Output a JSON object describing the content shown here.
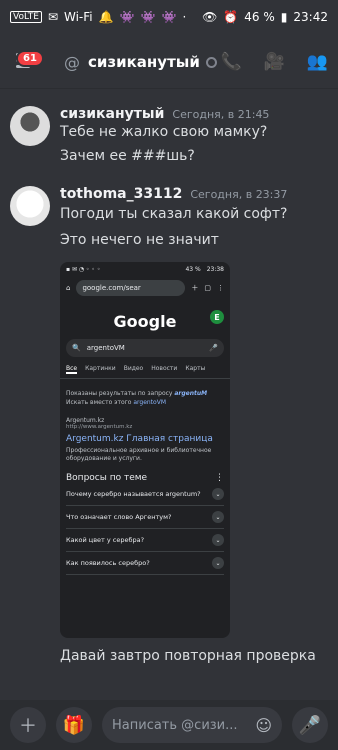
{
  "status": {
    "left_icons": [
      "VoLTE",
      "✉",
      "Wi‑Fi",
      "🔔",
      "👾",
      "👾",
      "👾",
      "·"
    ],
    "right": {
      "battery": "46 %",
      "time": "23:42"
    }
  },
  "header": {
    "badge_count": "61",
    "at_symbol": "@",
    "title": "сизиканутый",
    "icons": [
      "call-icon",
      "video-icon",
      "members-icon"
    ]
  },
  "messages": [
    {
      "username": "сизиканутый",
      "timestamp": "Сегодня, в 21:45",
      "lines": [
        "Тебе не жалко свою мамку?",
        "Зачем ее ###шь?"
      ]
    },
    {
      "username": "tothoma_33112",
      "timestamp": "Сегодня, в 23:37",
      "lines": [
        "Погоди ты сказал какой софт?",
        "Это нечего не значит"
      ],
      "after_image": "Давай завтро повторная проверка"
    }
  ],
  "screenshot": {
    "status_time": "23:38",
    "battery": "43 %",
    "url": "google.com/sear",
    "google_logo": "Google",
    "avatar_letter": "E",
    "query": "argentoVM",
    "tabs": [
      "Все",
      "Картинки",
      "Видео",
      "Новости",
      "Карты"
    ],
    "info_line1_prefix": "Показаны результаты по запросу ",
    "info_line1_term": "argentuM",
    "info_line2_prefix": "Искать вместо этого ",
    "info_line2_link": "argentoVM",
    "result_site": "Argentum.kz",
    "result_url": "http://www.argentum.kz",
    "result_title": "Argentum.kz Главная страница",
    "result_desc": "Профессиональное архивное и библиотечное оборудование и услуги.",
    "questions_title": "Вопросы по теме",
    "questions": [
      "Почему серебро называется argentum?",
      "Что означает слово Аргентум?",
      "Какой цвет у серебра?",
      "Как появилось серебро?"
    ]
  },
  "input": {
    "placeholder": "Написать @сизи..."
  }
}
